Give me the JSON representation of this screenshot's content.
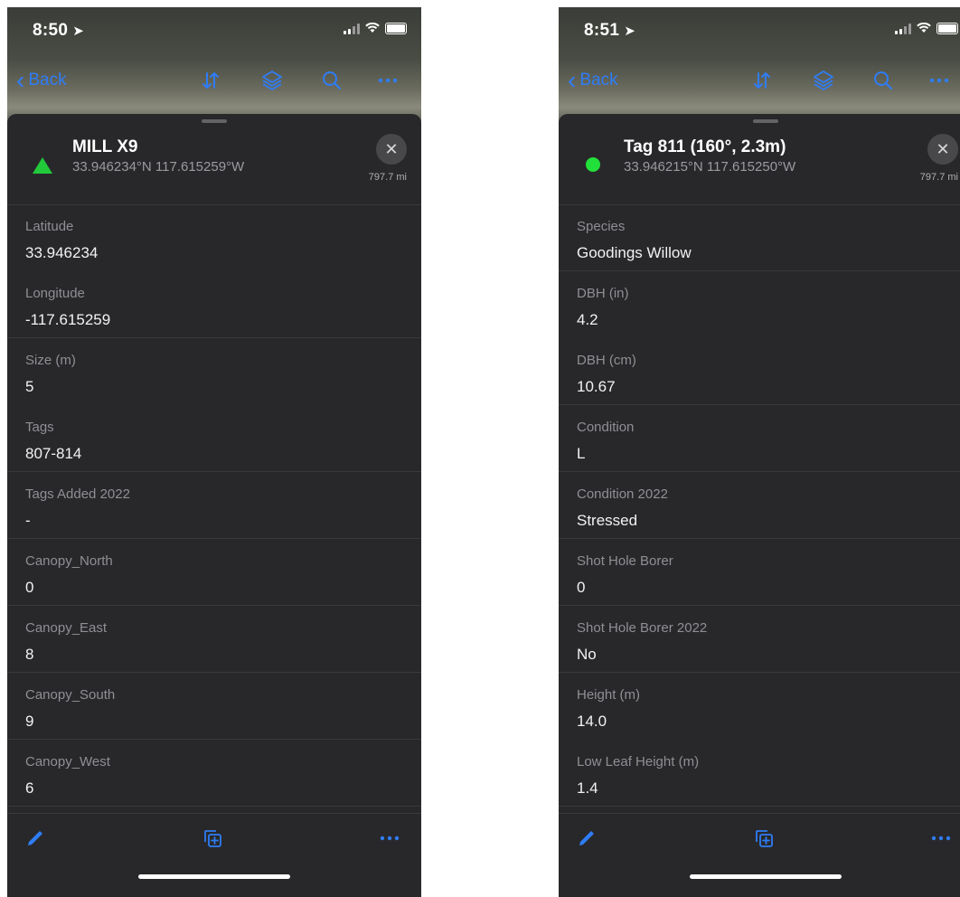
{
  "left": {
    "status_time": "8:50",
    "nav_back": "Back",
    "title": "MILL X9",
    "coords": "33.946234°N  117.615259°W",
    "distance": "797.7 mi",
    "fields": [
      {
        "label": "Latitude",
        "value": "33.946234"
      },
      {
        "label": "Longitude",
        "value": "-117.615259"
      },
      {
        "label": "Size (m)",
        "value": "5"
      },
      {
        "label": "Tags",
        "value": "807-814"
      },
      {
        "label": "Tags Added 2022",
        "value": "-"
      },
      {
        "label": "Canopy_North",
        "value": "0"
      },
      {
        "label": "Canopy_East",
        "value": "8"
      },
      {
        "label": "Canopy_South",
        "value": "9"
      },
      {
        "label": "Canopy_West",
        "value": "6"
      }
    ]
  },
  "right": {
    "status_time": "8:51",
    "nav_back": "Back",
    "title": "Tag 811 (160°, 2.3m)",
    "coords": "33.946215°N  117.615250°W",
    "distance": "797.7 mi",
    "fields": [
      {
        "label": "Species",
        "value": "Goodings Willow"
      },
      {
        "label": "DBH (in)",
        "value": "4.2"
      },
      {
        "label": "DBH (cm)",
        "value": "10.67"
      },
      {
        "label": "Condition",
        "value": "L"
      },
      {
        "label": "Condition 2022",
        "value": "Stressed"
      },
      {
        "label": "Shot Hole Borer",
        "value": "0"
      },
      {
        "label": "Shot Hole Borer 2022",
        "value": "No"
      },
      {
        "label": "Height (m)",
        "value": "14.0"
      },
      {
        "label": "Low Leaf Height (m)",
        "value": "1.4"
      }
    ]
  },
  "icons": {
    "location": "location-arrow-icon",
    "sort": "sort-arrows-icon",
    "layers": "layers-icon",
    "search": "search-icon",
    "more": "more-icon",
    "edit": "pencil-icon",
    "copy": "duplicate-icon",
    "close": "close-icon"
  },
  "colors": {
    "accent": "#2f7df6",
    "sheet_bg": "#28282b",
    "symbol_green": "#22c93a"
  }
}
